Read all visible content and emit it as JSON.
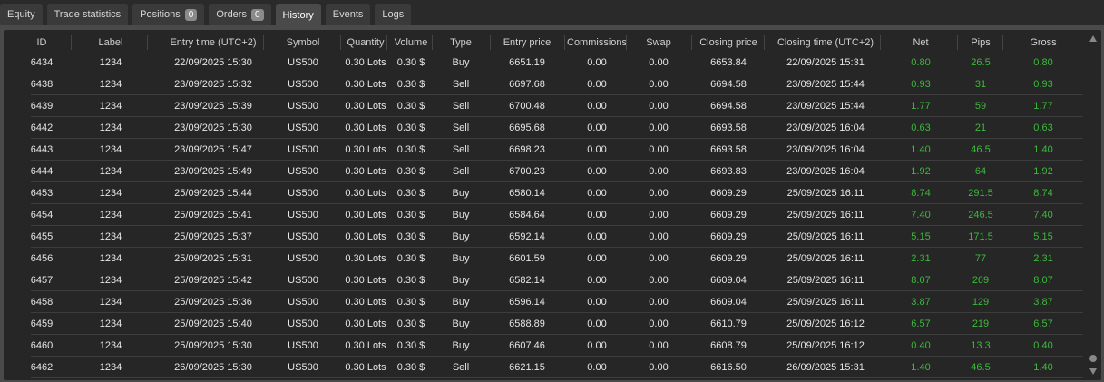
{
  "tabs": [
    {
      "label": "Equity"
    },
    {
      "label": "Trade statistics"
    },
    {
      "label": "Positions",
      "badge": "0"
    },
    {
      "label": "Orders",
      "badge": "0"
    },
    {
      "label": "History",
      "active": true
    },
    {
      "label": "Events"
    },
    {
      "label": "Logs"
    }
  ],
  "columns": [
    "ID",
    "Label",
    "Entry time (UTC+2)",
    "Symbol",
    "Quantity",
    "Volume",
    "Type",
    "Entry price",
    "Commissions",
    "Swap",
    "Closing price",
    "Closing time (UTC+2)",
    "Net",
    "Pips",
    "Gross"
  ],
  "colors": {
    "positive": "#3cb93c"
  },
  "rows": [
    [
      "6434",
      "1234",
      "22/09/2025 15:30",
      "US500",
      "0.30 Lots",
      "0.30 $",
      "Buy",
      "6651.19",
      "0.00",
      "0.00",
      "6653.84",
      "22/09/2025 15:31",
      "0.80",
      "26.5",
      "0.80"
    ],
    [
      "6438",
      "1234",
      "23/09/2025 15:32",
      "US500",
      "0.30 Lots",
      "0.30 $",
      "Sell",
      "6697.68",
      "0.00",
      "0.00",
      "6694.58",
      "23/09/2025 15:44",
      "0.93",
      "31",
      "0.93"
    ],
    [
      "6439",
      "1234",
      "23/09/2025 15:39",
      "US500",
      "0.30 Lots",
      "0.30 $",
      "Sell",
      "6700.48",
      "0.00",
      "0.00",
      "6694.58",
      "23/09/2025 15:44",
      "1.77",
      "59",
      "1.77"
    ],
    [
      "6442",
      "1234",
      "23/09/2025 15:30",
      "US500",
      "0.30 Lots",
      "0.30 $",
      "Sell",
      "6695.68",
      "0.00",
      "0.00",
      "6693.58",
      "23/09/2025 16:04",
      "0.63",
      "21",
      "0.63"
    ],
    [
      "6443",
      "1234",
      "23/09/2025 15:47",
      "US500",
      "0.30 Lots",
      "0.30 $",
      "Sell",
      "6698.23",
      "0.00",
      "0.00",
      "6693.58",
      "23/09/2025 16:04",
      "1.40",
      "46.5",
      "1.40"
    ],
    [
      "6444",
      "1234",
      "23/09/2025 15:49",
      "US500",
      "0.30 Lots",
      "0.30 $",
      "Sell",
      "6700.23",
      "0.00",
      "0.00",
      "6693.83",
      "23/09/2025 16:04",
      "1.92",
      "64",
      "1.92"
    ],
    [
      "6453",
      "1234",
      "25/09/2025 15:44",
      "US500",
      "0.30 Lots",
      "0.30 $",
      "Buy",
      "6580.14",
      "0.00",
      "0.00",
      "6609.29",
      "25/09/2025 16:11",
      "8.74",
      "291.5",
      "8.74"
    ],
    [
      "6454",
      "1234",
      "25/09/2025 15:41",
      "US500",
      "0.30 Lots",
      "0.30 $",
      "Buy",
      "6584.64",
      "0.00",
      "0.00",
      "6609.29",
      "25/09/2025 16:11",
      "7.40",
      "246.5",
      "7.40"
    ],
    [
      "6455",
      "1234",
      "25/09/2025 15:37",
      "US500",
      "0.30 Lots",
      "0.30 $",
      "Buy",
      "6592.14",
      "0.00",
      "0.00",
      "6609.29",
      "25/09/2025 16:11",
      "5.15",
      "171.5",
      "5.15"
    ],
    [
      "6456",
      "1234",
      "25/09/2025 15:31",
      "US500",
      "0.30 Lots",
      "0.30 $",
      "Buy",
      "6601.59",
      "0.00",
      "0.00",
      "6609.29",
      "25/09/2025 16:11",
      "2.31",
      "77",
      "2.31"
    ],
    [
      "6457",
      "1234",
      "25/09/2025 15:42",
      "US500",
      "0.30 Lots",
      "0.30 $",
      "Buy",
      "6582.14",
      "0.00",
      "0.00",
      "6609.04",
      "25/09/2025 16:11",
      "8.07",
      "269",
      "8.07"
    ],
    [
      "6458",
      "1234",
      "25/09/2025 15:36",
      "US500",
      "0.30 Lots",
      "0.30 $",
      "Buy",
      "6596.14",
      "0.00",
      "0.00",
      "6609.04",
      "25/09/2025 16:11",
      "3.87",
      "129",
      "3.87"
    ],
    [
      "6459",
      "1234",
      "25/09/2025 15:40",
      "US500",
      "0.30 Lots",
      "0.30 $",
      "Buy",
      "6588.89",
      "0.00",
      "0.00",
      "6610.79",
      "25/09/2025 16:12",
      "6.57",
      "219",
      "6.57"
    ],
    [
      "6460",
      "1234",
      "25/09/2025 15:30",
      "US500",
      "0.30 Lots",
      "0.30 $",
      "Buy",
      "6607.46",
      "0.00",
      "0.00",
      "6608.79",
      "25/09/2025 16:12",
      "0.40",
      "13.3",
      "0.40"
    ],
    [
      "6462",
      "1234",
      "26/09/2025 15:30",
      "US500",
      "0.30 Lots",
      "0.30 $",
      "Sell",
      "6621.15",
      "0.00",
      "0.00",
      "6616.50",
      "26/09/2025 15:31",
      "1.40",
      "46.5",
      "1.40"
    ]
  ]
}
